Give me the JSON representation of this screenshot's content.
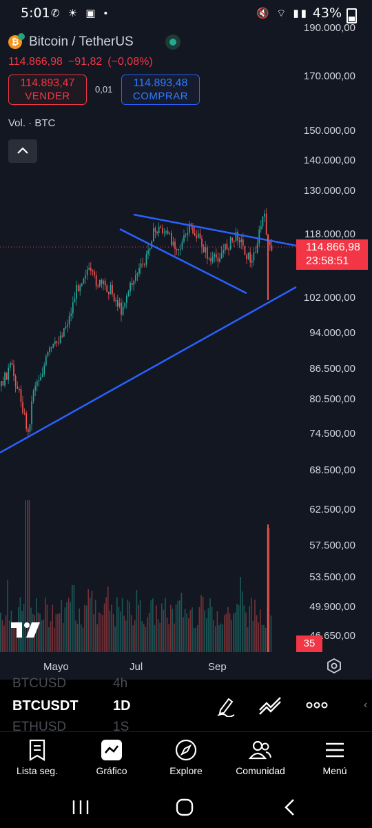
{
  "status_bar": {
    "time": "5:01",
    "battery": "43%"
  },
  "symbol": {
    "name": "Bitcoin / TetherUS",
    "last_price": "114.866,98",
    "change": "−91,82",
    "change_pct": "(−0,08%)",
    "sell_price": "114.893,47",
    "sell_label": "VENDER",
    "spread": "0,01",
    "buy_price": "114.893,48",
    "buy_label": "COMPRAR",
    "volume_label": "Vol. · BTC"
  },
  "price_axis": [
    "190.000,00",
    "170.000,00",
    "150.000,00",
    "140.000,00",
    "130.000,00",
    "118.000,00",
    "102.000,00",
    "94.000,00",
    "86.500,00",
    "80.500,00",
    "74.500,00",
    "68.500,00",
    "62.500,00",
    "57.500,00",
    "53.500,00",
    "49.900,00",
    "46.650,00"
  ],
  "current_price_tag": {
    "price": "114.866,98",
    "countdown": "23:58:51"
  },
  "volume_tag": "35",
  "time_axis": [
    "Mayo",
    "Jul",
    "Sep"
  ],
  "toolbar": {
    "symbol_prev": "BTCUSD",
    "interval_prev": "4h",
    "symbol": "BTCUSDT",
    "interval": "1D",
    "symbol_next": "ETHUSD",
    "interval_next": "1S"
  },
  "bottom_nav": [
    {
      "label": "Lista seg.",
      "icon": "watchlist-icon"
    },
    {
      "label": "Gráfico",
      "icon": "chart-icon"
    },
    {
      "label": "Explore",
      "icon": "compass-icon"
    },
    {
      "label": "Comunidad",
      "icon": "community-icon"
    },
    {
      "label": "Menú",
      "icon": "menu-icon"
    }
  ],
  "colors": {
    "background": "#131722",
    "up": "#26a69a",
    "down": "#ef5350",
    "trendline": "#2962ff",
    "accent_red": "#f23645"
  }
}
